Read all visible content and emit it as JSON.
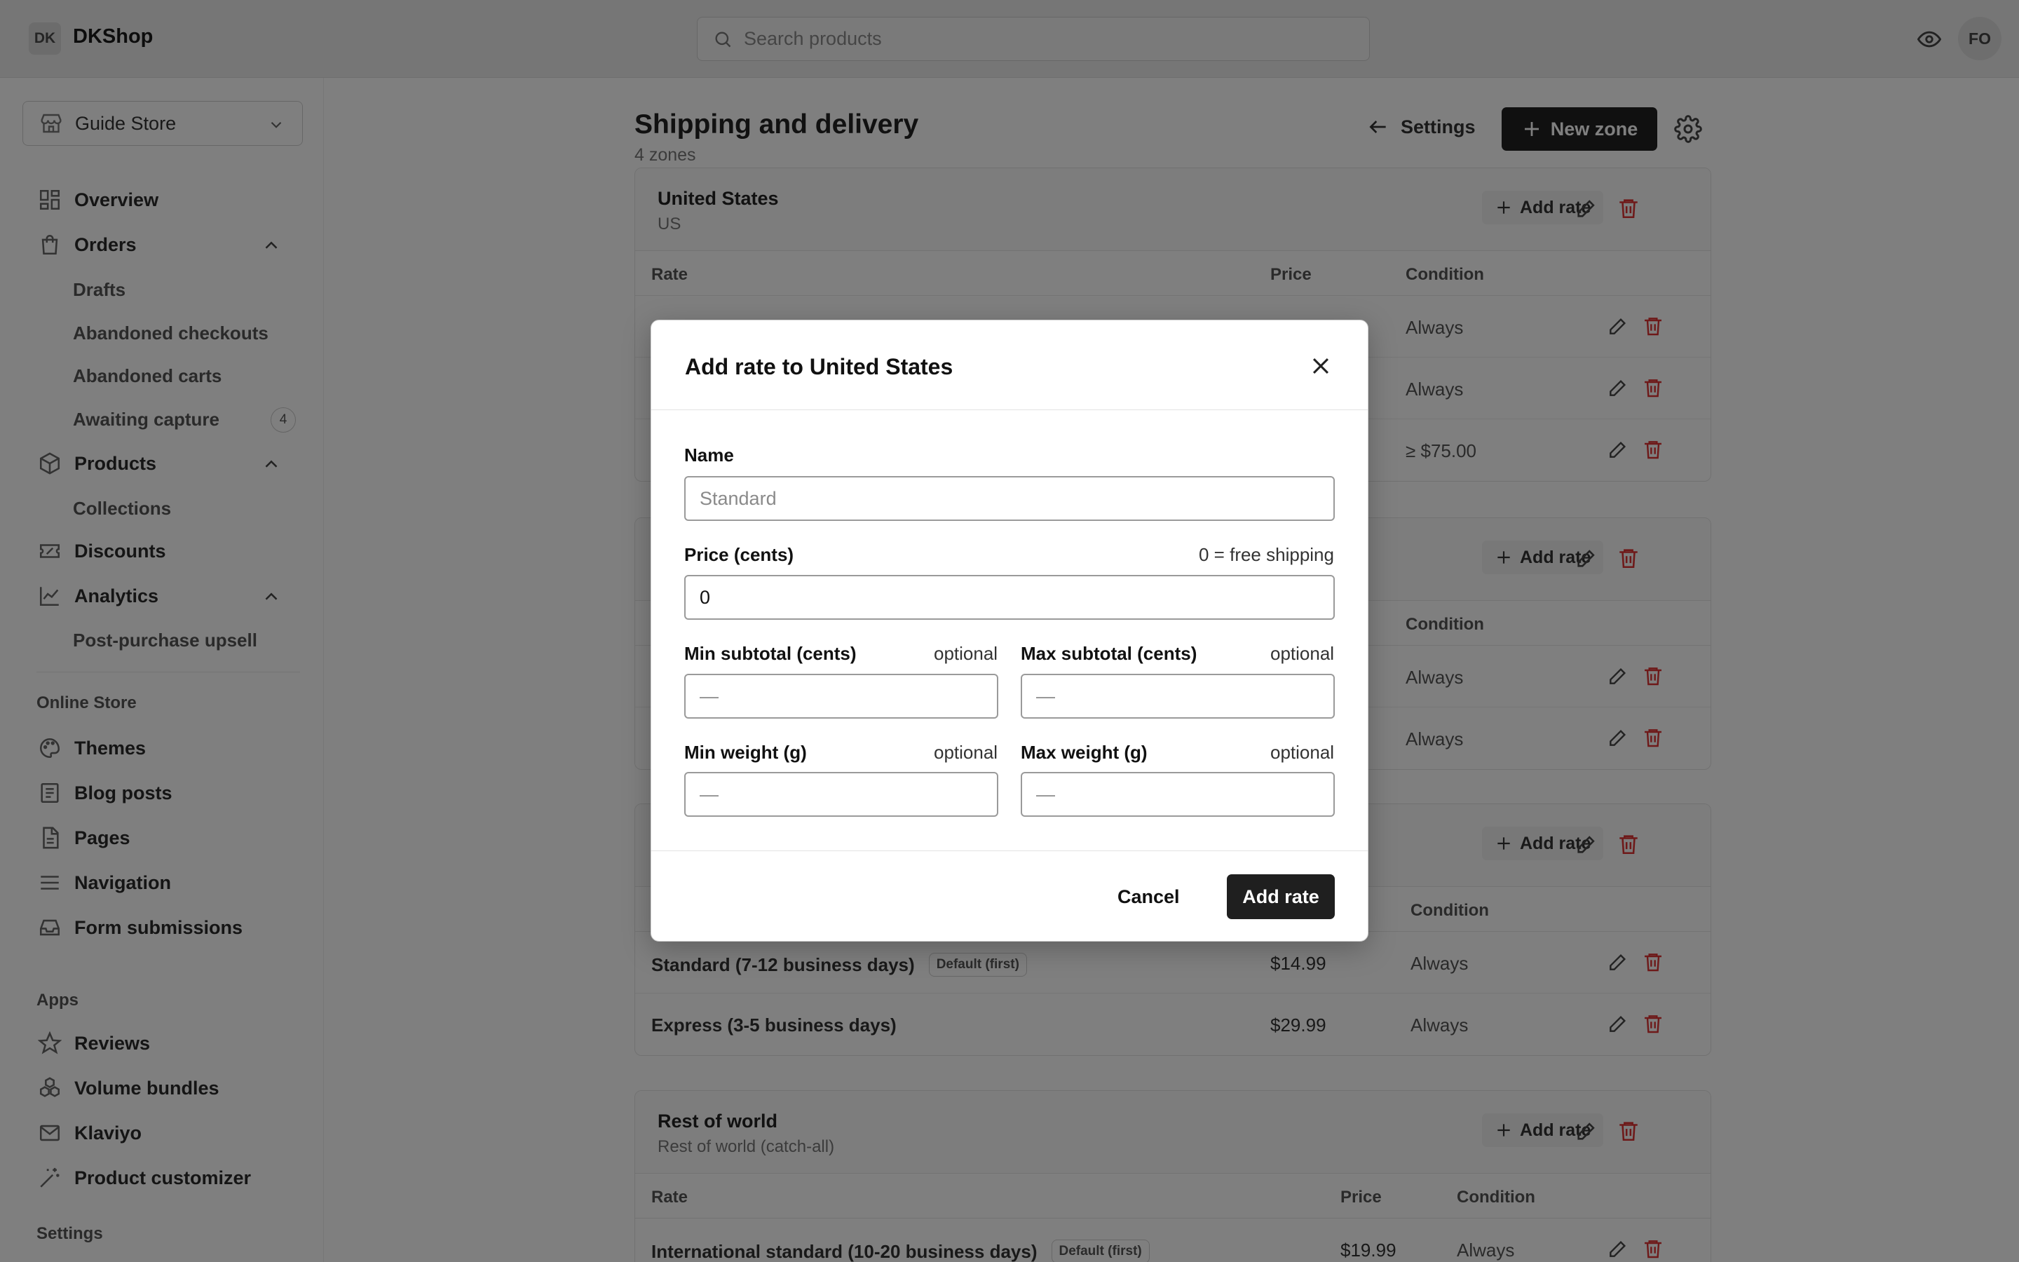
{
  "topbar": {
    "logo": "DK",
    "brand": "DKShop",
    "search_placeholder": "Search products",
    "avatar": "FO"
  },
  "sidebar": {
    "store": "Guide Store",
    "nav": {
      "overview": "Overview",
      "orders": "Orders",
      "drafts": "Drafts",
      "abandoned_checkouts": "Abandoned checkouts",
      "abandoned_carts": "Abandoned carts",
      "awaiting_capture": "Awaiting capture",
      "awaiting_capture_count": "4",
      "products": "Products",
      "collections": "Collections",
      "discounts": "Discounts",
      "analytics": "Analytics",
      "post_purchase_upsell": "Post-purchase upsell"
    },
    "online_store_label": "Online Store",
    "online_store": {
      "themes": "Themes",
      "blog_posts": "Blog posts",
      "pages": "Pages",
      "navigation": "Navigation",
      "form_submissions": "Form submissions"
    },
    "apps_label": "Apps",
    "apps": {
      "reviews": "Reviews",
      "volume_bundles": "Volume bundles",
      "klaviyo": "Klaviyo",
      "product_customizer": "Product customizer"
    },
    "settings_label": "Settings"
  },
  "main": {
    "title": "Shipping and delivery",
    "subtitle": "4 zones",
    "back_label": "Settings",
    "new_zone_label": "New zone",
    "add_rate_label": "Add rate",
    "col_rate": "Rate",
    "col_price": "Price",
    "col_condition": "Condition",
    "zone_us": {
      "name": "United States",
      "code": "US",
      "rows": [
        {
          "price": "",
          "condition": "Always"
        },
        {
          "price": "",
          "condition": "Always"
        },
        {
          "price": "",
          "condition": "≥ $75.00"
        }
      ]
    },
    "zone_two_rows": [
      {
        "condition": "Always"
      },
      {
        "condition": "Always"
      }
    ],
    "zone_three_rows": [
      {
        "name": "Standard (7-12 business days)",
        "tag": "Default (first)",
        "price": "$14.99",
        "condition": "Always"
      },
      {
        "name": "Express (3-5 business days)",
        "tag": "",
        "price": "$29.99",
        "condition": "Always"
      }
    ],
    "zone_world": {
      "name": "Rest of world",
      "code": "Rest of world (catch-all)",
      "rows": [
        {
          "name": "International standard (10-20 business days)",
          "tag": "Default (first)",
          "price": "$19.99",
          "condition": "Always"
        }
      ]
    }
  },
  "modal": {
    "title": "Add rate to United States",
    "name_label": "Name",
    "name_placeholder": "Standard",
    "price_label": "Price (cents)",
    "price_hint": "0 = free shipping",
    "price_value": "0",
    "min_subtotal_label": "Min subtotal (cents)",
    "max_subtotal_label": "Max subtotal (cents)",
    "min_weight_label": "Min weight (g)",
    "max_weight_label": "Max weight (g)",
    "optional": "optional",
    "empty_placeholder": "—",
    "cancel_label": "Cancel",
    "submit_label": "Add rate"
  }
}
